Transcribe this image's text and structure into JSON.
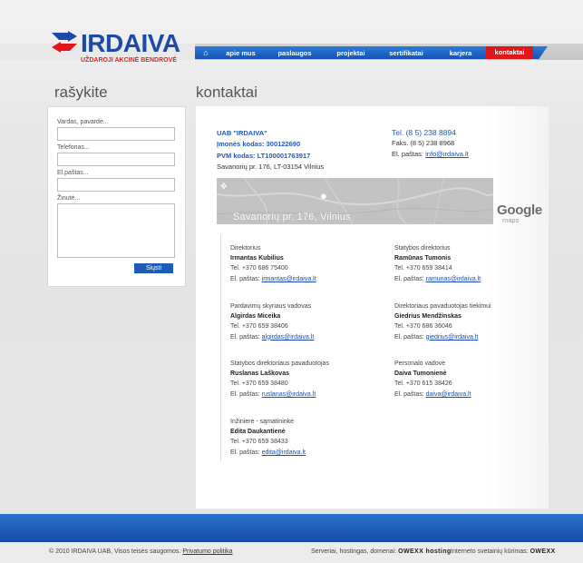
{
  "brand": {
    "name": "IRDAIVA",
    "subtitle": "UŽDAROJI AKCINĖ BENDROVĖ",
    "accent_blue": "#1b4aa8",
    "accent_red": "#e0161b"
  },
  "nav": {
    "home_icon": "home-icon",
    "items": [
      {
        "label": "apie mus"
      },
      {
        "label": "paslaugos"
      },
      {
        "label": "projektai"
      },
      {
        "label": "sertifikatai"
      },
      {
        "label": "karjera"
      },
      {
        "label": "kontaktai",
        "active": true
      }
    ]
  },
  "form": {
    "title": "rašykite",
    "name_label": "Vardas, pavardė...",
    "phone_label": "Telefonas...",
    "email_label": "El.paštas...",
    "message_label": "Žinutė...",
    "name_value": "",
    "phone_value": "",
    "email_value": "",
    "message_value": "",
    "submit_label": "Siųsti"
  },
  "contacts": {
    "title": "kontaktai",
    "company_name": "UAB \"IRDAIVA\"",
    "company_code": "Įmonės kodas: 300122690",
    "vat_code": "PVM kodas: LT100001763917",
    "address": "Savanorių pr. 176, LT-03154 Vilnius",
    "tel": "Tel. (8 5) 238 8894",
    "fax": "Faks. (8 5) 238 8968",
    "email_prefix": "El. paštas:",
    "email": "info@irdaiva.lt"
  },
  "map": {
    "address_overlay": "Savanorių pr. 176, Vilnius",
    "provider_logo": "Google",
    "provider_sub": "maps"
  },
  "people": [
    {
      "role": "Direktorius",
      "name": "Irmantas Kubilius",
      "phone": "Tel. +370 686 75400",
      "email_prefix": "El. paštas:",
      "email": "irmantas@irdaiva.lt"
    },
    {
      "role": "Statybos direktorius",
      "name": "Ramūnas Tumonis",
      "phone": "Tel. +370 659 38414",
      "email_prefix": "El. paštas:",
      "email": "ramunas@irdaiva.lt"
    },
    {
      "role": "Pardavimų skyriaus vadovas",
      "name": "Algirdas Miceika",
      "phone": "Tel. +370 659 38406",
      "email_prefix": "El. paštas:",
      "email": "algirdas@irdaiva.lt"
    },
    {
      "role": "Direktoriaus pavaduotojas tiekimui",
      "name": "Giedrius Mendžinskas",
      "phone": "Tel. +370 686 36046",
      "email_prefix": "El. paštas:",
      "email": "giedrius@irdaiva.lt"
    },
    {
      "role": "Statybos direktoriaus pavaduotojas",
      "name": "Ruslanas Laškovas",
      "phone": "Tel. +370 659 38480",
      "email_prefix": "El. paštas:",
      "email": "ruslanas@irdaiva.lt"
    },
    {
      "role": "Personalo vadovė",
      "name": "Daiva Tumonienė",
      "phone": "Tel. +370 615 38426",
      "email_prefix": "El. paštas:",
      "email": "daiva@irdaiva.lt"
    },
    {
      "role": "Inžinierė - sąmatininkė",
      "name": "Edita Daukantienė",
      "phone": "Tel. +370 659 38433",
      "email_prefix": "El. paštas:",
      "email": "edita@irdaiva.lt"
    }
  ],
  "footer": {
    "copyright": "© 2010 IRDAIVA UAB, Visos teisės saugomos.",
    "privacy_link": "Privatumo politika",
    "hosting_text": "Serveriai, hostingas, domenai:",
    "hosting_brand": "OWEXX hosting",
    "design_text": "Interneto svetainių kūrimas:",
    "design_brand": "OWEXX"
  }
}
